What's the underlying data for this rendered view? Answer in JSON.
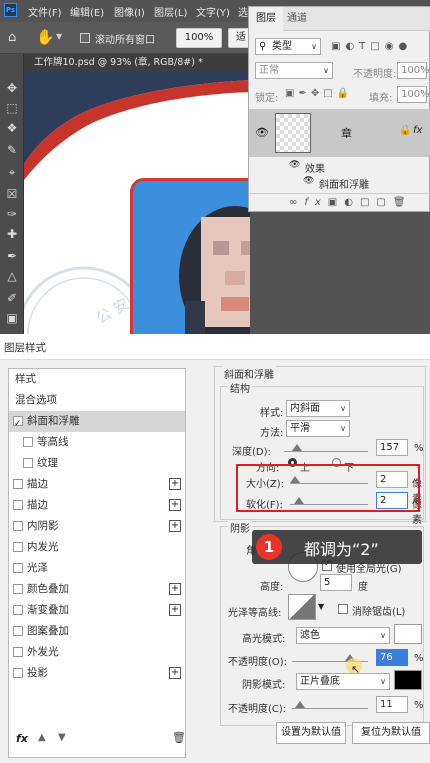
{
  "menubar": {
    "logo": "Ps",
    "items": [
      "文件(F)",
      "编辑(E)",
      "图像(I)",
      "图层(L)",
      "文字(Y)",
      "选"
    ]
  },
  "options": {
    "scroll_all_label": "滚动所有窗口",
    "zoom": "100%",
    "fit_label": "适"
  },
  "document": {
    "tab_title": "工作牌10.psd @ 93% (章, RGB/8#) *"
  },
  "layers_panel": {
    "tab_layers": "图层",
    "tab_channels": "通道",
    "kind_label": "类型",
    "blend_mode": "正常",
    "opacity_label": "不透明度:",
    "opacity_value": "100%",
    "lock_label": "锁定:",
    "fill_label": "填充:",
    "fill_value": "100%",
    "layer_name": "章",
    "effects_label": "效果",
    "effect_bevel": "斜面和浮雕"
  },
  "dialog": {
    "title": "图层样式",
    "style_list": [
      {
        "label": "样式",
        "checkbox": false,
        "checked": false,
        "plus": false,
        "selected": false,
        "indent": false
      },
      {
        "label": "混合选项",
        "checkbox": false,
        "checked": false,
        "plus": false,
        "selected": false,
        "indent": false
      },
      {
        "label": "斜面和浮雕",
        "checkbox": true,
        "checked": true,
        "plus": false,
        "selected": true,
        "indent": false
      },
      {
        "label": "等高线",
        "checkbox": true,
        "checked": false,
        "plus": false,
        "selected": false,
        "indent": true
      },
      {
        "label": "纹理",
        "checkbox": true,
        "checked": false,
        "plus": false,
        "selected": false,
        "indent": true
      },
      {
        "label": "描边",
        "checkbox": true,
        "checked": false,
        "plus": true,
        "selected": false,
        "indent": false
      },
      {
        "label": "描边",
        "checkbox": true,
        "checked": false,
        "plus": true,
        "selected": false,
        "indent": false
      },
      {
        "label": "内阴影",
        "checkbox": true,
        "checked": false,
        "plus": true,
        "selected": false,
        "indent": false
      },
      {
        "label": "内发光",
        "checkbox": true,
        "checked": false,
        "plus": false,
        "selected": false,
        "indent": false
      },
      {
        "label": "光泽",
        "checkbox": true,
        "checked": false,
        "plus": false,
        "selected": false,
        "indent": false
      },
      {
        "label": "颜色叠加",
        "checkbox": true,
        "checked": false,
        "plus": true,
        "selected": false,
        "indent": false
      },
      {
        "label": "渐变叠加",
        "checkbox": true,
        "checked": false,
        "plus": true,
        "selected": false,
        "indent": false
      },
      {
        "label": "图案叠加",
        "checkbox": true,
        "checked": false,
        "plus": false,
        "selected": false,
        "indent": false
      },
      {
        "label": "外发光",
        "checkbox": true,
        "checked": false,
        "plus": false,
        "selected": false,
        "indent": false
      },
      {
        "label": "投影",
        "checkbox": true,
        "checked": false,
        "plus": true,
        "selected": false,
        "indent": false
      }
    ],
    "fx_label": "fx",
    "bevel": {
      "section_title": "斜面和浮雕",
      "structure_title": "结构",
      "style_label": "样式:",
      "style_value": "内斜面",
      "method_label": "方法:",
      "method_value": "平滑",
      "depth_label": "深度(D):",
      "depth_value": "157",
      "depth_unit": "%",
      "depth_level": 0.16,
      "direction_label": "方向:",
      "dir_up": "上",
      "dir_down": "下",
      "size_label": "大小(Z):",
      "size_value": "2",
      "size_unit": "像素",
      "soften_label": "软化(F):",
      "soften_value": "2",
      "soften_unit": "像素"
    },
    "shading": {
      "title": "阴影",
      "angle_label": "角",
      "global_light_label": "使用全局光(G)",
      "altitude_label": "高度:",
      "altitude_value": "5",
      "altitude_unit": "度",
      "gloss_label": "光泽等高线:",
      "antialias_label": "消除锯齿(L)",
      "highlight_mode_label": "高光模式:",
      "highlight_mode_value": "滤色",
      "highlight_color": "#ffffff",
      "highlight_opacity_label": "不透明度(O):",
      "highlight_opacity_value": "76",
      "highlight_opacity_unit": "%",
      "highlight_opacity_level": 0.76,
      "shadow_mode_label": "阴影模式:",
      "shadow_mode_value": "正片叠底",
      "shadow_color": "#000000",
      "shadow_opacity_label": "不透明度(C):",
      "shadow_opacity_value": "11",
      "shadow_opacity_unit": "%",
      "shadow_opacity_level": 0.11
    },
    "btn_set_default": "设置为默认值",
    "btn_reset_default": "复位为默认值"
  },
  "callout": {
    "step": "1",
    "text": "都调为“2”"
  },
  "colors": {
    "highlight_box": "#e02020",
    "callout_badge": "#e8322a",
    "photo_bg": "#3b8fdc",
    "card_border": "#d03a32"
  }
}
